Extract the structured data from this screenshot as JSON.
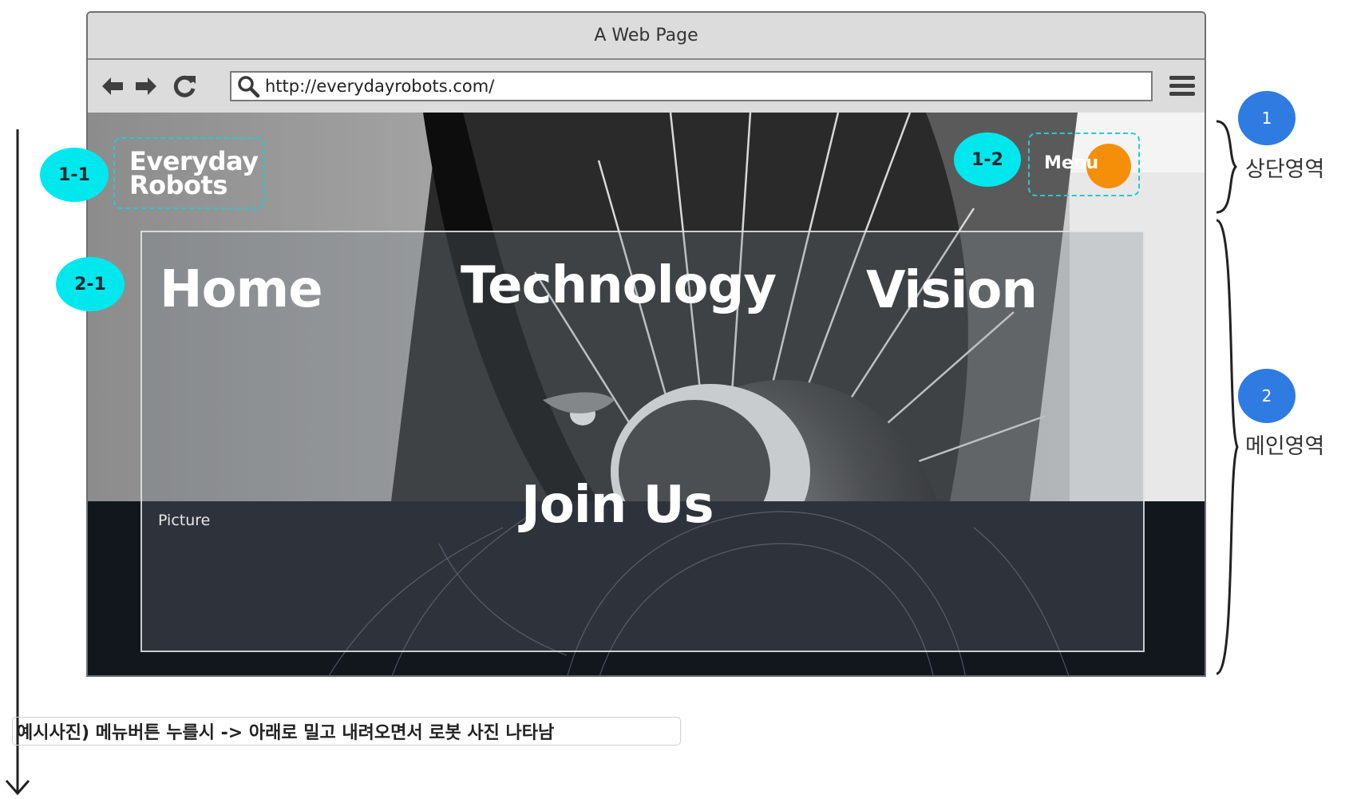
{
  "browser": {
    "title": "A Web Page",
    "url": "http://everydayrobots.com/"
  },
  "site": {
    "logo_line1": "Everyday",
    "logo_line2": "Robots",
    "menu_label": "Menu",
    "menu_dot_color": "#f58f0a",
    "nav_items": [
      "Home",
      "Technology",
      "Vision",
      "Join Us"
    ],
    "picture_label": "Picture"
  },
  "annotations": {
    "badge_logo": "1-1",
    "badge_menu": "1-2",
    "badge_nav": "2-1",
    "section1_number": "1",
    "section1_label": "상단영역",
    "section2_number": "2",
    "section2_label": "메인영역",
    "caption": "예시사진) 메뉴버튼 누를시 -> 아래로 밀고 내려오면서 로봇 사진 나타남",
    "badge_color": "#00e8ee",
    "section_badge_color": "#2e7be2",
    "dashed_outline_color": "#25c9d4"
  },
  "icons": {
    "back": "arrow-left-icon",
    "forward": "arrow-right-icon",
    "reload": "reload-icon",
    "search": "search-icon",
    "menu": "hamburger-icon"
  }
}
